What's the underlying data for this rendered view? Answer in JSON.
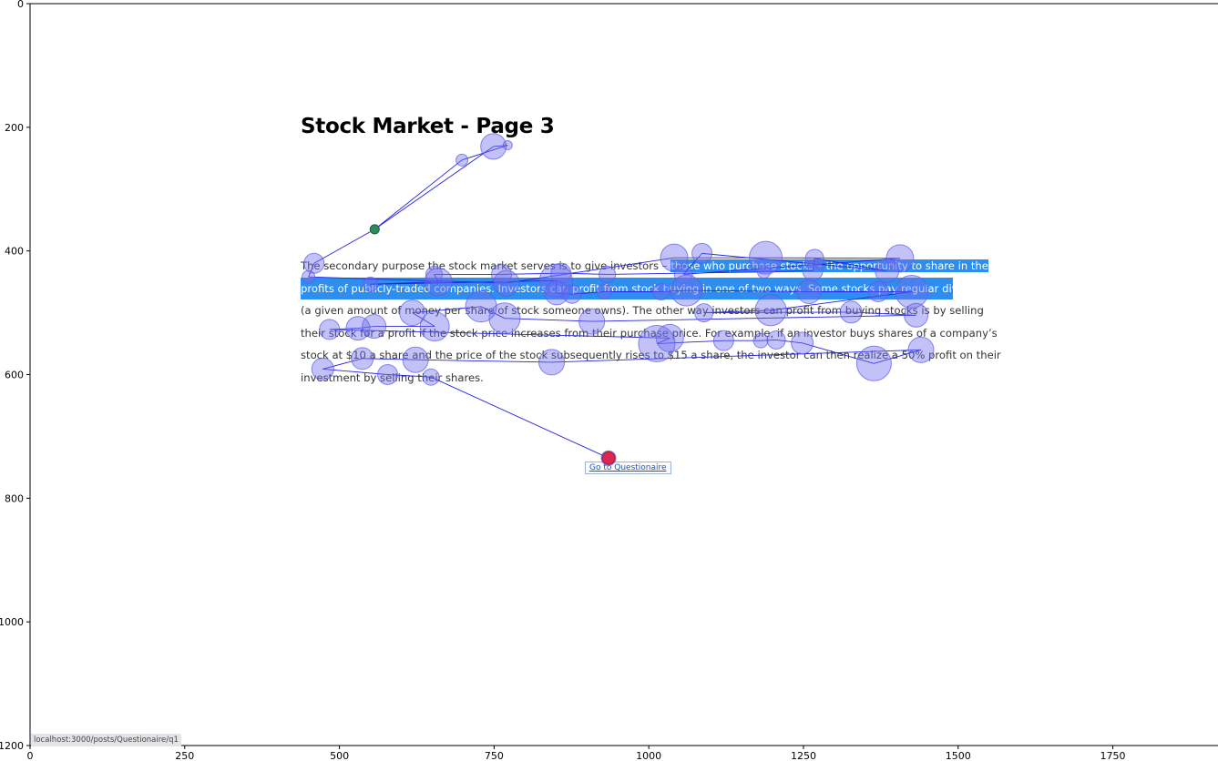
{
  "page": {
    "title": "Stock Market - Page 3",
    "passage_lines": [
      {
        "pre": "The secondary purpose the stock market serves is to give investors – ",
        "hl": "those who purchase stocks – the opportunity to share in the"
      },
      {
        "full": "profits of publicly-traded companies. Investors can profit from stock buying in one of two ways. Some stocks pay regular dividends"
      },
      {
        "pre": "(a given amount of money per share of stock someone owns). The other way investors can profit from buying stocks is by selling"
      },
      {
        "pre": "their stock for a profit if the stock price increases from their purchase price. For example, if an investor buys shares of a company’s"
      },
      {
        "pre": "stock at $10 a share and the price of the stock subsequently rises to $15 a share, the investor can then realize a 50% profit on their"
      },
      {
        "pre": "investment by selling their shares."
      }
    ],
    "link_label": "Go to Questionaire",
    "status_url": "localhost:3000/posts/Questionaire/q1"
  },
  "axes": {
    "x_ticks": [
      0,
      250,
      500,
      750,
      1000,
      1250,
      1500,
      1750
    ],
    "y_ticks": [
      0,
      200,
      400,
      600,
      800,
      1000,
      1200
    ],
    "x_range": [
      0,
      1920
    ],
    "y_range": [
      0,
      1200
    ]
  },
  "colors": {
    "fixation": "#6e6ef0",
    "scanpath": "#2323e0",
    "start_marker": "#2e8b57",
    "end_marker": "#dc2850",
    "highlight": "#2d8ef0"
  },
  "scanpath": {
    "start": {
      "x": 557,
      "y": 365
    },
    "end": {
      "x": 935,
      "y": 735
    },
    "fixations": [
      {
        "x": 557,
        "y": 365,
        "d": 10
      },
      {
        "x": 749,
        "y": 231,
        "d": 28
      },
      {
        "x": 698,
        "y": 253,
        "d": 13
      },
      {
        "x": 772,
        "y": 229,
        "d": 10
      },
      {
        "x": 1041,
        "y": 411,
        "d": 30
      },
      {
        "x": 1086,
        "y": 404,
        "d": 22
      },
      {
        "x": 1189,
        "y": 411,
        "d": 36
      },
      {
        "x": 1268,
        "y": 412,
        "d": 20
      },
      {
        "x": 1406,
        "y": 412,
        "d": 30
      },
      {
        "x": 1385,
        "y": 432,
        "d": 26
      },
      {
        "x": 1265,
        "y": 432,
        "d": 22
      },
      {
        "x": 1186,
        "y": 434,
        "d": 14
      },
      {
        "x": 1056,
        "y": 438,
        "d": 20
      },
      {
        "x": 933,
        "y": 438,
        "d": 18
      },
      {
        "x": 858,
        "y": 436,
        "d": 22
      },
      {
        "x": 762,
        "y": 438,
        "d": 22
      },
      {
        "x": 653,
        "y": 438,
        "d": 18
      },
      {
        "x": 459,
        "y": 420,
        "d": 22
      },
      {
        "x": 450,
        "y": 442,
        "d": 14
      },
      {
        "x": 550,
        "y": 454,
        "d": 16
      },
      {
        "x": 660,
        "y": 450,
        "d": 30
      },
      {
        "x": 770,
        "y": 452,
        "d": 28
      },
      {
        "x": 850,
        "y": 448,
        "d": 36
      },
      {
        "x": 851,
        "y": 468,
        "d": 26
      },
      {
        "x": 876,
        "y": 470,
        "d": 20
      },
      {
        "x": 928,
        "y": 466,
        "d": 16
      },
      {
        "x": 1020,
        "y": 466,
        "d": 18
      },
      {
        "x": 1061,
        "y": 464,
        "d": 34
      },
      {
        "x": 1259,
        "y": 466,
        "d": 26
      },
      {
        "x": 1371,
        "y": 466,
        "d": 22
      },
      {
        "x": 1425,
        "y": 466,
        "d": 36
      },
      {
        "x": 1197,
        "y": 496,
        "d": 34
      },
      {
        "x": 1089,
        "y": 500,
        "d": 20
      },
      {
        "x": 1327,
        "y": 499,
        "d": 24
      },
      {
        "x": 1432,
        "y": 504,
        "d": 26
      },
      {
        "x": 908,
        "y": 514,
        "d": 28
      },
      {
        "x": 767,
        "y": 509,
        "d": 34
      },
      {
        "x": 729,
        "y": 490,
        "d": 34
      },
      {
        "x": 618,
        "y": 500,
        "d": 28
      },
      {
        "x": 654,
        "y": 522,
        "d": 32
      },
      {
        "x": 556,
        "y": 522,
        "d": 26
      },
      {
        "x": 530,
        "y": 525,
        "d": 26
      },
      {
        "x": 484,
        "y": 527,
        "d": 22
      },
      {
        "x": 1034,
        "y": 541,
        "d": 30
      },
      {
        "x": 1013,
        "y": 550,
        "d": 40
      },
      {
        "x": 1121,
        "y": 545,
        "d": 22
      },
      {
        "x": 1181,
        "y": 545,
        "d": 16
      },
      {
        "x": 1206,
        "y": 544,
        "d": 20
      },
      {
        "x": 1248,
        "y": 549,
        "d": 24
      },
      {
        "x": 1364,
        "y": 582,
        "d": 38
      },
      {
        "x": 1440,
        "y": 560,
        "d": 28
      },
      {
        "x": 843,
        "y": 580,
        "d": 28
      },
      {
        "x": 623,
        "y": 576,
        "d": 28
      },
      {
        "x": 537,
        "y": 574,
        "d": 24
      },
      {
        "x": 473,
        "y": 591,
        "d": 24
      },
      {
        "x": 578,
        "y": 600,
        "d": 22
      },
      {
        "x": 648,
        "y": 604,
        "d": 18
      },
      {
        "x": 935,
        "y": 735,
        "d": 16
      }
    ],
    "order": [
      0,
      1,
      3,
      2,
      0,
      17,
      18,
      21,
      4,
      6,
      8,
      12,
      5,
      9,
      7,
      10,
      11,
      13,
      14,
      15,
      16,
      20,
      19,
      22,
      23,
      24,
      25,
      26,
      27,
      28,
      29,
      30,
      31,
      32,
      33,
      34,
      35,
      36,
      37,
      38,
      39,
      40,
      41,
      42,
      43,
      44,
      45,
      46,
      47,
      48,
      49,
      50,
      51,
      52,
      53,
      54,
      55,
      56,
      57
    ]
  }
}
